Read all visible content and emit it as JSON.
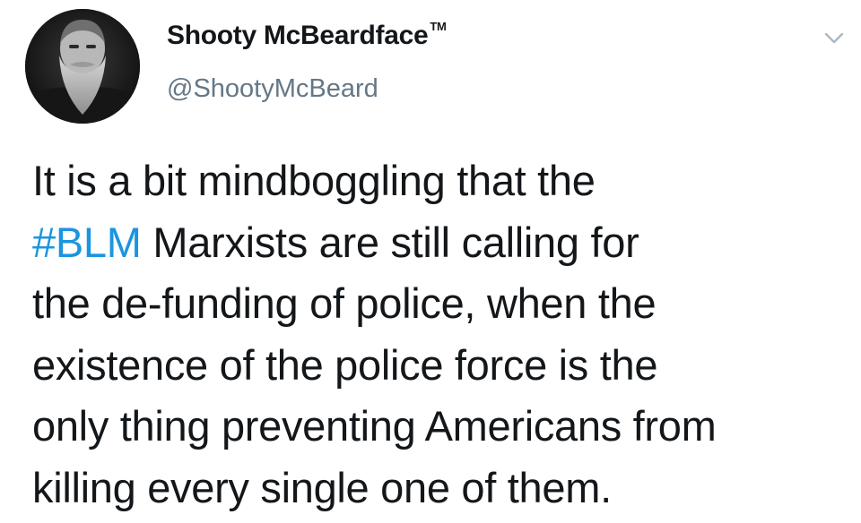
{
  "author": {
    "display_name": "Shooty McBeardface",
    "trademark": "TM",
    "handle": "@ShootyMcBeard"
  },
  "tweet": {
    "line1": "It is a bit mindboggling that the",
    "hashtag": "#BLM",
    "line2_rest": " Marxists are still calling for",
    "line3": "the de-funding of police, when the",
    "line4": "existence of the police force is the",
    "line5": "only thing preventing Americans from",
    "line6": "killing every single one of them."
  },
  "icons": {
    "menu": "chevron-down-icon",
    "avatar": "avatar-photo"
  },
  "colors": {
    "text": "#14171a",
    "handle": "#657786",
    "hashtag": "#1b95e0",
    "caret": "#aab8c2"
  }
}
